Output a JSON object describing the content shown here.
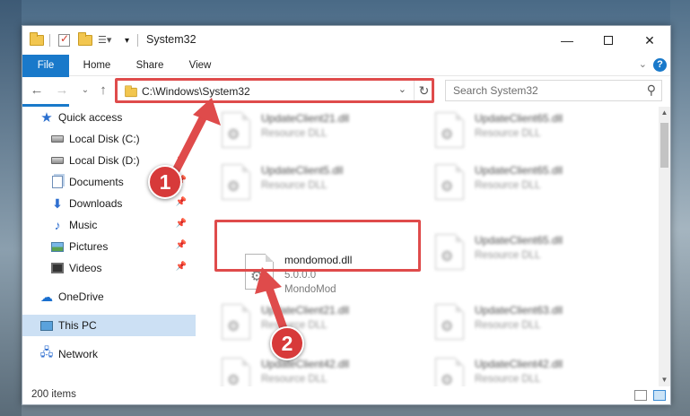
{
  "window": {
    "title": "System32"
  },
  "ribbon": {
    "tabs": [
      "File",
      "Home",
      "Share",
      "View"
    ],
    "help": "?"
  },
  "address": {
    "path": "C:\\Windows\\System32"
  },
  "search": {
    "placeholder": "Search System32"
  },
  "sidebar": {
    "items": [
      {
        "label": "Quick access",
        "icon": "star-icon"
      },
      {
        "label": "Local Disk (C:)",
        "icon": "drive-icon"
      },
      {
        "label": "Local Disk (D:)",
        "icon": "drive-icon"
      },
      {
        "label": "Documents",
        "icon": "documents-icon"
      },
      {
        "label": "Downloads",
        "icon": "downloads-icon"
      },
      {
        "label": "Music",
        "icon": "music-icon"
      },
      {
        "label": "Pictures",
        "icon": "pictures-icon"
      },
      {
        "label": "Videos",
        "icon": "videos-icon"
      },
      {
        "label": "OneDrive",
        "icon": "onedrive-icon"
      },
      {
        "label": "This PC",
        "icon": "this-pc-icon"
      },
      {
        "label": "Network",
        "icon": "network-icon"
      }
    ]
  },
  "files": [
    {
      "name": "UpdateClient21.dll",
      "type": "Resource DLL"
    },
    {
      "name": "UpdateClient65.dll",
      "type": "Resource DLL"
    },
    {
      "name": "UpdateClient5.dll",
      "type": "Resource DLL"
    },
    {
      "name": "UpdateClient65.dll",
      "type": "Resource DLL"
    },
    {
      "name": "mondomod.dll",
      "version": "5.0.0.0",
      "company": "MondoMod"
    },
    {
      "name": "UpdateClient65.dll",
      "type": "Resource DLL"
    },
    {
      "name": "UpdateClient21.dll",
      "type": "Resource DLL"
    },
    {
      "name": "UpdateClient63.dll",
      "type": "Resource DLL"
    },
    {
      "name": "UpdateClient42.dll",
      "type": "Resource DLL"
    },
    {
      "name": "UpdateClient42.dll",
      "type": "Resource DLL"
    }
  ],
  "status": {
    "count": "200 items"
  },
  "annotations": {
    "badge1": "1",
    "badge2": "2",
    "color": "#df4b4b"
  }
}
